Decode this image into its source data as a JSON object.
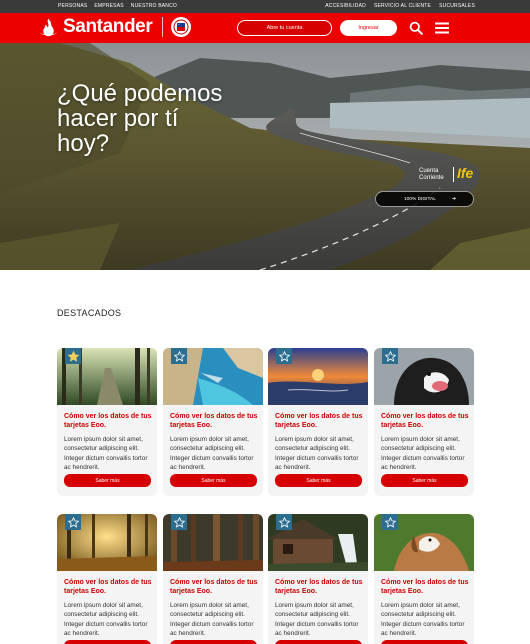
{
  "topbar": {
    "left_links": [
      "PERSONAS",
      "EMPRESAS",
      "NUESTRO BANCO"
    ],
    "right_links": [
      "ACCESIBILIDAD",
      "SERVICIO AL CLIENTE",
      "SUCURSALES"
    ]
  },
  "header": {
    "brand": "Santander",
    "open_account_label": "Abre tu cuenta",
    "login_label": "Ingresar",
    "colors": {
      "brand_red": "#ec0000",
      "white": "#ffffff"
    },
    "icons": [
      "santander-flame-icon",
      "chile-seal-icon",
      "search-icon",
      "menu-icon"
    ]
  },
  "hero": {
    "headline": "¿Qué podemos hacer por tí hoy?",
    "tag_line1": "Cuenta",
    "tag_line2": "Corriente",
    "ife": "Ife",
    "cta_label": "100% DIGITAL",
    "cta_arrow": "➔"
  },
  "featured": {
    "section_title": "DESTACADOS",
    "cards": [
      {
        "image": "forest-path",
        "title": "Cómo ver los datos de tus tarjetas Eoo.",
        "body": "Lorem ipsum dolor sit amet, consectetur adipiscing elit. Integer dictum convallis tortor ac hendrerit.",
        "button": "Saber más",
        "favorite": true
      },
      {
        "image": "beach-cove",
        "title": "Cómo ver los datos de tus tarjetas Eoo.",
        "body": "Lorem ipsum dolor sit amet, consectetur adipiscing elit. Integer dictum convallis tortor ac hendrerit.",
        "button": "Saber más",
        "favorite": false
      },
      {
        "image": "sunset-shore",
        "title": "Cómo ver los datos de tus tarjetas Eoo.",
        "body": "Lorem ipsum dolor sit amet, consectetur adipiscing elit. Integer dictum convallis tortor ac hendrerit.",
        "button": "Saber más",
        "favorite": false
      },
      {
        "image": "dog-portrait",
        "title": "Cómo ver los datos de tus tarjetas Eoo.",
        "body": "Lorem ipsum dolor sit amet, consectetur adipiscing elit. Integer dictum convallis tortor ac hendrerit.",
        "button": "Saber más",
        "favorite": false
      },
      {
        "image": "autumn-forest",
        "title": "Cómo ver los datos de tus tarjetas Eoo.",
        "body": "Lorem ipsum dolor sit amet, consectetur adipiscing elit. Integer dictum convallis tortor ac hendrerit.",
        "button": "Saber más",
        "favorite": false
      },
      {
        "image": "pine-forest",
        "title": "Cómo ver los datos de tus tarjetas Eoo.",
        "body": "Lorem ipsum dolor sit amet, consectetur adipiscing elit. Integer dictum convallis tortor ac hendrerit.",
        "button": "Saber más",
        "favorite": false
      },
      {
        "image": "watermill",
        "title": "Cómo ver los datos de tus tarjetas Eoo.",
        "body": "Lorem ipsum dolor sit amet, consectetur adipiscing elit. Integer dictum convallis tortor ac hendrerit.",
        "button": "Saber más",
        "favorite": false
      },
      {
        "image": "dog-lying",
        "title": "Cómo ver los datos de tus tarjetas Eoo.",
        "body": "Lorem ipsum dolor sit amet, consectetur adipiscing elit. Integer dictum convallis tortor ac hendrerit.",
        "button": "Saber más",
        "favorite": false
      }
    ]
  }
}
